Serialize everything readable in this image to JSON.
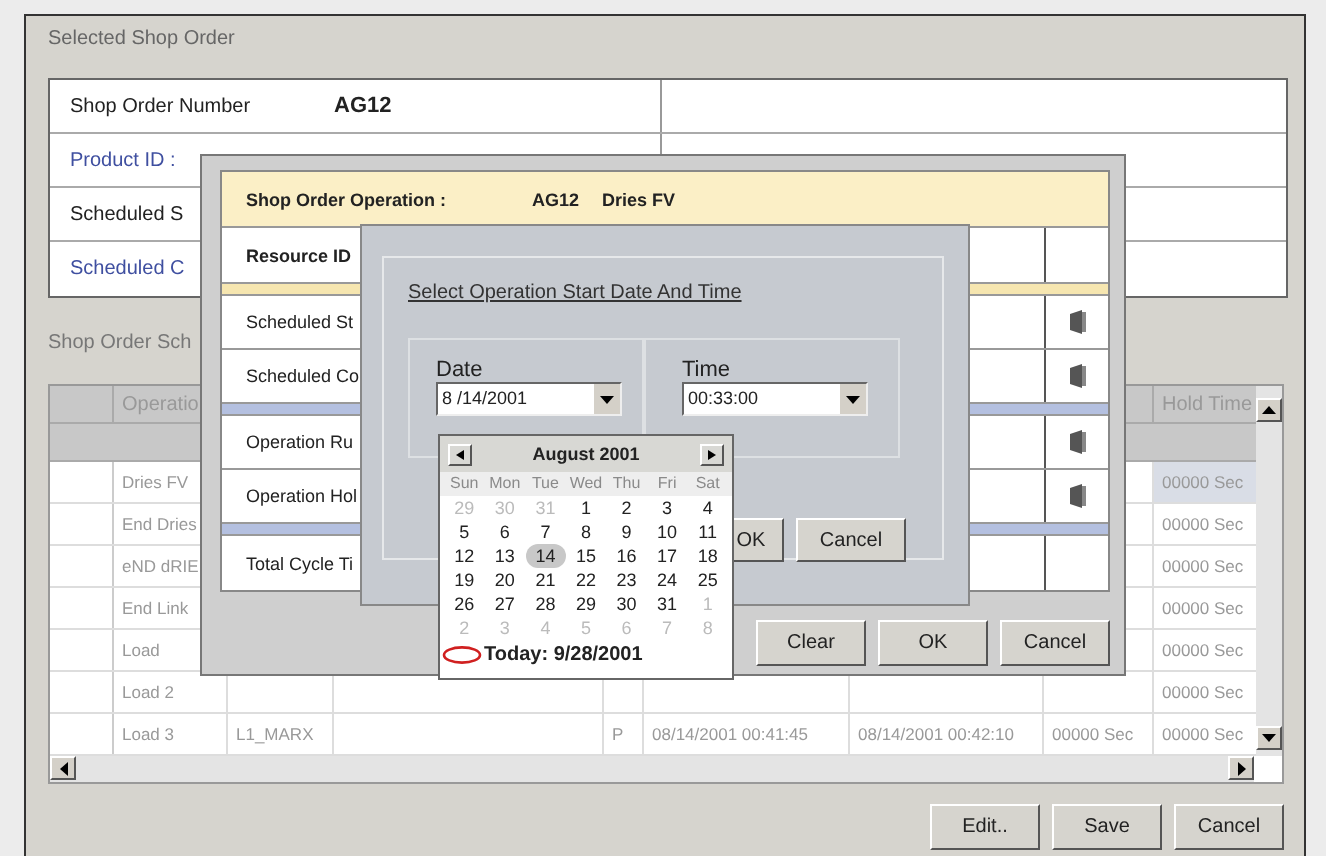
{
  "window": {
    "group_title": "Selected Shop Order"
  },
  "shop_order": [
    {
      "label": "Shop Order Number",
      "value": "AG12",
      "kind": "plain"
    },
    {
      "label": "Product ID :",
      "kind": "link"
    },
    {
      "label": "Scheduled S",
      "kind": "plain"
    },
    {
      "label": "Scheduled C",
      "kind": "link"
    }
  ],
  "schedule": {
    "title": "Shop Order Sch",
    "columns": {
      "operation": "Operatio",
      "hold_time": "Hold Time"
    },
    "rows": [
      {
        "operation": "Dries FV",
        "hold_time": "00000 Sec",
        "selected": true
      },
      {
        "operation": "End Dries",
        "hold_time": "00000 Sec",
        "selected": false
      },
      {
        "operation": "eND dRIE",
        "hold_time": "00000 Sec",
        "selected": false
      },
      {
        "operation": "End Link",
        "hold_time": "00000 Sec",
        "selected": false
      },
      {
        "operation": "Load",
        "hold_time": "00000 Sec",
        "selected": false
      },
      {
        "operation": "Load 2",
        "hold_time": "00000 Sec",
        "selected": false
      },
      {
        "operation": "Load 3",
        "column_2": "L1_MARX",
        "column_4": "P",
        "start": "08/14/2001 00:41:45",
        "end": "08/14/2001 00:42:10",
        "column_7": "00000 Sec",
        "hold_time": "00000 Sec",
        "selected": false
      }
    ]
  },
  "buttons": [
    "Edit..",
    "Save",
    "Cancel"
  ],
  "operation_dialog": {
    "header_label": "Shop Order Operation :",
    "order": "AG12",
    "operation": "Dries FV",
    "rows": [
      {
        "kind": "row",
        "label": "Resource ID",
        "icon": false
      },
      {
        "kind": "separator",
        "color": "#f6e6b0"
      },
      {
        "kind": "row",
        "label": "Scheduled St",
        "icon": true
      },
      {
        "kind": "row",
        "label": "Scheduled Co",
        "icon": true
      },
      {
        "kind": "separator",
        "color": "#b4c0e0"
      },
      {
        "kind": "row",
        "label": "Operation Ru",
        "icon": true
      },
      {
        "kind": "row",
        "label": "Operation Hol",
        "icon": true
      },
      {
        "kind": "separator",
        "color": "#b4c0e0"
      },
      {
        "kind": "row",
        "label": "Total Cycle Ti",
        "icon": false
      }
    ],
    "buttons": [
      "Clear",
      "OK",
      "Cancel"
    ]
  },
  "date_dialog": {
    "title": "Select Operation Start Date And Time",
    "date_label": "Date",
    "date_value": "8 /14/2001",
    "time_label": "Time",
    "time_value": "00:33:00",
    "buttons": [
      "OK",
      "Cancel"
    ]
  },
  "calendar": {
    "month": "August 2001",
    "weekdays": [
      "Sun",
      "Mon",
      "Tue",
      "Wed",
      "Thu",
      "Fri",
      "Sat"
    ],
    "weeks": [
      [
        {
          "d": "29",
          "muted": true,
          "selected": false
        },
        {
          "d": "30",
          "muted": true,
          "selected": false
        },
        {
          "d": "31",
          "muted": true,
          "selected": false
        },
        {
          "d": "1",
          "muted": false,
          "selected": false
        },
        {
          "d": "2",
          "muted": false,
          "selected": false
        },
        {
          "d": "3",
          "muted": false,
          "selected": false
        },
        {
          "d": "4",
          "muted": false,
          "selected": false
        }
      ],
      [
        {
          "d": "5",
          "muted": false,
          "selected": false
        },
        {
          "d": "6",
          "muted": false,
          "selected": false
        },
        {
          "d": "7",
          "muted": false,
          "selected": false
        },
        {
          "d": "8",
          "muted": false,
          "selected": false
        },
        {
          "d": "9",
          "muted": false,
          "selected": false
        },
        {
          "d": "10",
          "muted": false,
          "selected": false
        },
        {
          "d": "11",
          "muted": false,
          "selected": false
        }
      ],
      [
        {
          "d": "12",
          "muted": false,
          "selected": false
        },
        {
          "d": "13",
          "muted": false,
          "selected": false
        },
        {
          "d": "14",
          "muted": false,
          "selected": true
        },
        {
          "d": "15",
          "muted": false,
          "selected": false
        },
        {
          "d": "16",
          "muted": false,
          "selected": false
        },
        {
          "d": "17",
          "muted": false,
          "selected": false
        },
        {
          "d": "18",
          "muted": false,
          "selected": false
        }
      ],
      [
        {
          "d": "19",
          "muted": false,
          "selected": false
        },
        {
          "d": "20",
          "muted": false,
          "selected": false
        },
        {
          "d": "21",
          "muted": false,
          "selected": false
        },
        {
          "d": "22",
          "muted": false,
          "selected": false
        },
        {
          "d": "23",
          "muted": false,
          "selected": false
        },
        {
          "d": "24",
          "muted": false,
          "selected": false
        },
        {
          "d": "25",
          "muted": false,
          "selected": false
        }
      ],
      [
        {
          "d": "26",
          "muted": false,
          "selected": false
        },
        {
          "d": "27",
          "muted": false,
          "selected": false
        },
        {
          "d": "28",
          "muted": false,
          "selected": false
        },
        {
          "d": "29",
          "muted": false,
          "selected": false
        },
        {
          "d": "30",
          "muted": false,
          "selected": false
        },
        {
          "d": "31",
          "muted": false,
          "selected": false
        },
        {
          "d": "1",
          "muted": true,
          "selected": false
        }
      ],
      [
        {
          "d": "2",
          "muted": true,
          "selected": false
        },
        {
          "d": "3",
          "muted": true,
          "selected": false
        },
        {
          "d": "4",
          "muted": true,
          "selected": false
        },
        {
          "d": "5",
          "muted": true,
          "selected": false
        },
        {
          "d": "6",
          "muted": true,
          "selected": false
        },
        {
          "d": "7",
          "muted": true,
          "selected": false
        },
        {
          "d": "8",
          "muted": true,
          "selected": false
        }
      ]
    ],
    "today": "Today: 9/28/2001"
  }
}
